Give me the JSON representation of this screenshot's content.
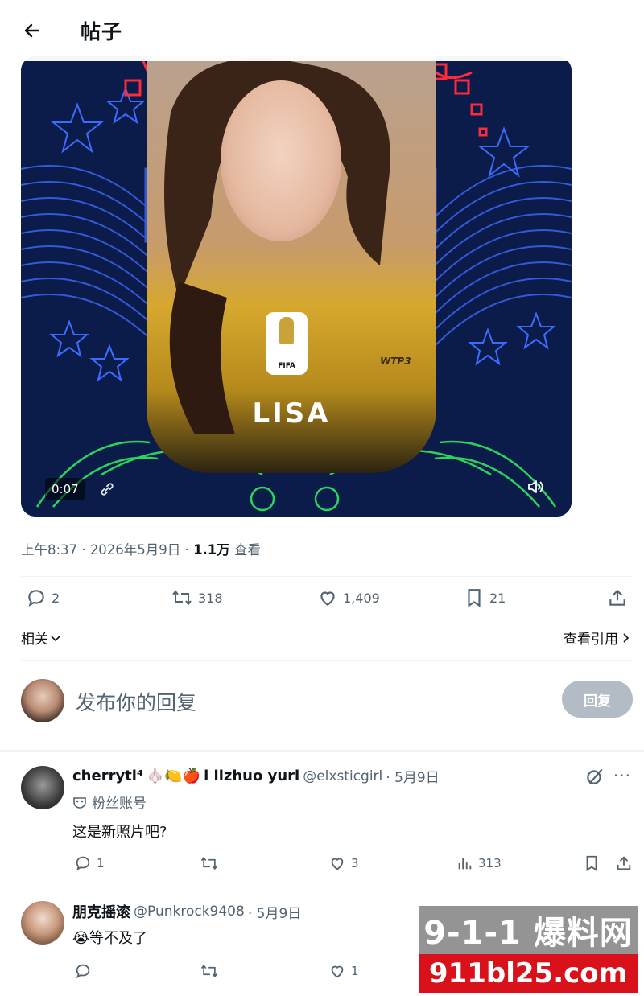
{
  "header": {
    "title": "帖子",
    "back_icon": "arrow-left-icon"
  },
  "media": {
    "duration": "0:07",
    "overlay_name": "LISA",
    "badge_text": "FIFA",
    "tag_text": "WTP3",
    "colors": {
      "background": "#0b1b4a",
      "neon_blue": "#3b6cff",
      "neon_red": "#ff2a3a",
      "neon_green": "#2bd45a",
      "jersey_yellow": "#d6a82e"
    }
  },
  "post_meta": {
    "time": "上午8:37",
    "date": "2026年5月9日",
    "views_count": "1.1万",
    "views_label": "查看"
  },
  "actions": {
    "replies": "2",
    "reposts": "318",
    "likes": "1,409",
    "bookmarks": "21"
  },
  "related": {
    "label": "相关",
    "view_quotes": "查看引用"
  },
  "reply_composer": {
    "placeholder": "发布你的回复",
    "button_label": "回复"
  },
  "replies": [
    {
      "name": "cherryti⁴",
      "name_emojis": "🧄🍋🍎",
      "name_suffix": "l lizhuo yuri",
      "handle": "@elxsticgirl",
      "date": "· 5月9日",
      "fan_badge": "粉丝账号",
      "text": "这是新照片吧?",
      "replies": "1",
      "reposts": "",
      "likes": "3",
      "views": "313"
    },
    {
      "name": "朋克摇滚",
      "handle": "@Punkrock9408",
      "date": "· 5月9日",
      "emoji": "😭",
      "text": "等不及了",
      "replies": "",
      "reposts": "",
      "likes": "1"
    }
  ],
  "watermark": {
    "top_text": "9-1-1 爆料网",
    "bottom_text": "911bl25.com",
    "accent": "#d8111a"
  }
}
